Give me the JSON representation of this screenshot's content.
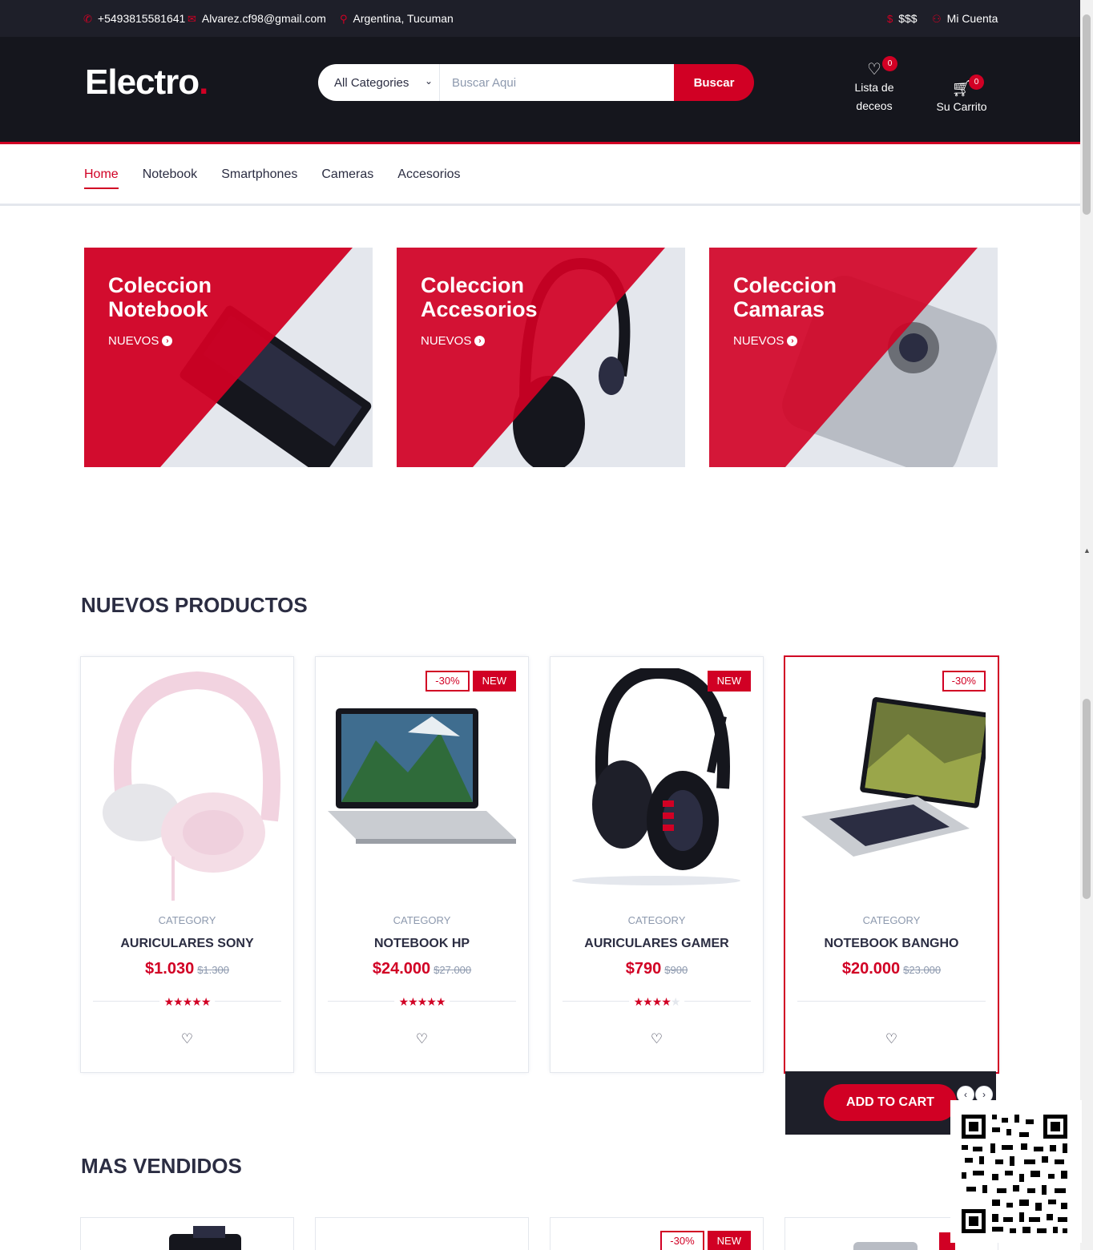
{
  "topbar": {
    "phone": "+5493815581641",
    "email": "Alvarez.cf98@gmail.com",
    "location": "Argentina, Tucuman",
    "currency": "$$$",
    "account": "Mi Cuenta"
  },
  "header": {
    "logo": "Electro",
    "logo_dot": ".",
    "category_select": "All Categories",
    "search_placeholder": "Buscar Aqui",
    "search_button": "Buscar",
    "wishlist": {
      "label_line1": "Lista de",
      "label_line2": "deceos",
      "count": "0"
    },
    "cart": {
      "label": "Su Carrito",
      "count": "0"
    }
  },
  "nav": {
    "items": [
      {
        "label": "Home",
        "active": true
      },
      {
        "label": "Notebook"
      },
      {
        "label": "Smartphones"
      },
      {
        "label": "Cameras"
      },
      {
        "label": "Accesorios"
      }
    ]
  },
  "collections": [
    {
      "line1": "Coleccion",
      "line2": "Notebook",
      "cta": "NUEVOS"
    },
    {
      "line1": "Coleccion",
      "line2": "Accesorios",
      "cta": "NUEVOS"
    },
    {
      "line1": "Coleccion",
      "line2": "Camaras",
      "cta": "NUEVOS"
    }
  ],
  "new_products": {
    "title": "NUEVOS PRODUCTOS",
    "products": [
      {
        "category": "CATEGORY",
        "name": "AURICULARES SONY",
        "price": "$1.030",
        "old_price": "$1.300",
        "rating": 5,
        "sale": "",
        "new": ""
      },
      {
        "category": "CATEGORY",
        "name": "NOTEBOOK HP",
        "price": "$24.000",
        "old_price": "$27.000",
        "rating": 5,
        "sale": "-30%",
        "new": "NEW"
      },
      {
        "category": "CATEGORY",
        "name": "AURICULARES GAMER",
        "price": "$790",
        "old_price": "$900",
        "rating": 4,
        "sale": "",
        "new": "NEW"
      },
      {
        "category": "CATEGORY",
        "name": "NOTEBOOK BANGHO",
        "price": "$20.000",
        "old_price": "$23.000",
        "rating": 0,
        "sale": "-30%",
        "new": ""
      }
    ],
    "add_to_cart": "ADD TO CART"
  },
  "top_selling": {
    "title": "MAS VENDIDOS",
    "labels": {
      "sale": "-30%",
      "new": "NEW"
    }
  },
  "colors": {
    "accent": "#d10024",
    "dark": "#15161d",
    "topbar": "#1e1f29"
  }
}
